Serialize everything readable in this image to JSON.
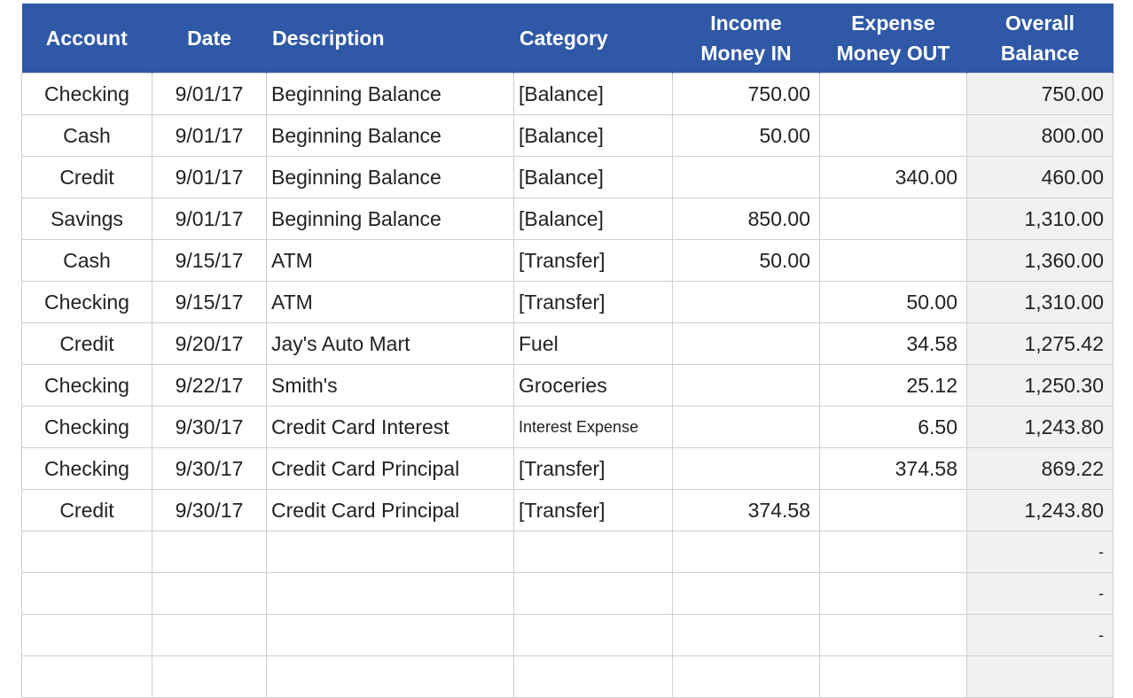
{
  "headers": [
    {
      "key": "account",
      "label": "Account"
    },
    {
      "key": "date",
      "label": "Date"
    },
    {
      "key": "description",
      "label": "Description"
    },
    {
      "key": "category",
      "label": "Category"
    },
    {
      "key": "income",
      "label_line1": "Income",
      "label_line2": "Money IN"
    },
    {
      "key": "expense",
      "label_line1": "Expense",
      "label_line2": "Money OUT"
    },
    {
      "key": "balance",
      "label_line1": "Overall",
      "label_line2": "Balance"
    }
  ],
  "rows": [
    {
      "account": "Checking",
      "date": "9/01/17",
      "description": "Beginning Balance",
      "category": "[Balance]",
      "income": "750.00",
      "expense": "",
      "balance": "750.00"
    },
    {
      "account": "Cash",
      "date": "9/01/17",
      "description": "Beginning Balance",
      "category": "[Balance]",
      "income": "50.00",
      "expense": "",
      "balance": "800.00"
    },
    {
      "account": "Credit",
      "date": "9/01/17",
      "description": "Beginning Balance",
      "category": "[Balance]",
      "income": "",
      "expense": "340.00",
      "balance": "460.00"
    },
    {
      "account": "Savings",
      "date": "9/01/17",
      "description": "Beginning Balance",
      "category": "[Balance]",
      "income": "850.00",
      "expense": "",
      "balance": "1,310.00"
    },
    {
      "account": "Cash",
      "date": "9/15/17",
      "description": "ATM",
      "category": "[Transfer]",
      "income": "50.00",
      "expense": "",
      "balance": "1,360.00"
    },
    {
      "account": "Checking",
      "date": "9/15/17",
      "description": "ATM",
      "category": "[Transfer]",
      "income": "",
      "expense": "50.00",
      "balance": "1,310.00"
    },
    {
      "account": "Credit",
      "date": "9/20/17",
      "description": "Jay's Auto Mart",
      "category": "Fuel",
      "income": "",
      "expense": "34.58",
      "balance": "1,275.42"
    },
    {
      "account": "Checking",
      "date": "9/22/17",
      "description": "Smith's",
      "category": "Groceries",
      "income": "",
      "expense": "25.12",
      "balance": "1,250.30"
    },
    {
      "account": "Checking",
      "date": "9/30/17",
      "description": "Credit Card Interest",
      "category": "Interest Expense",
      "income": "",
      "expense": "6.50",
      "balance": "1,243.80"
    },
    {
      "account": "Checking",
      "date": "9/30/17",
      "description": "Credit Card Principal",
      "category": "[Transfer]",
      "income": "",
      "expense": "374.58",
      "balance": "869.22"
    },
    {
      "account": "Credit",
      "date": "9/30/17",
      "description": "Credit Card Principal",
      "category": "[Transfer]",
      "income": "374.58",
      "expense": "",
      "balance": "1,243.80"
    },
    {
      "account": "",
      "date": "",
      "description": "",
      "category": "",
      "income": "",
      "expense": "",
      "balance": "-"
    },
    {
      "account": "",
      "date": "",
      "description": "",
      "category": "",
      "income": "",
      "expense": "",
      "balance": "-"
    },
    {
      "account": "",
      "date": "",
      "description": "",
      "category": "",
      "income": "",
      "expense": "",
      "balance": "-"
    },
    {
      "account": "",
      "date": "",
      "description": "",
      "category": "",
      "income": "",
      "expense": "",
      "balance": ""
    }
  ]
}
